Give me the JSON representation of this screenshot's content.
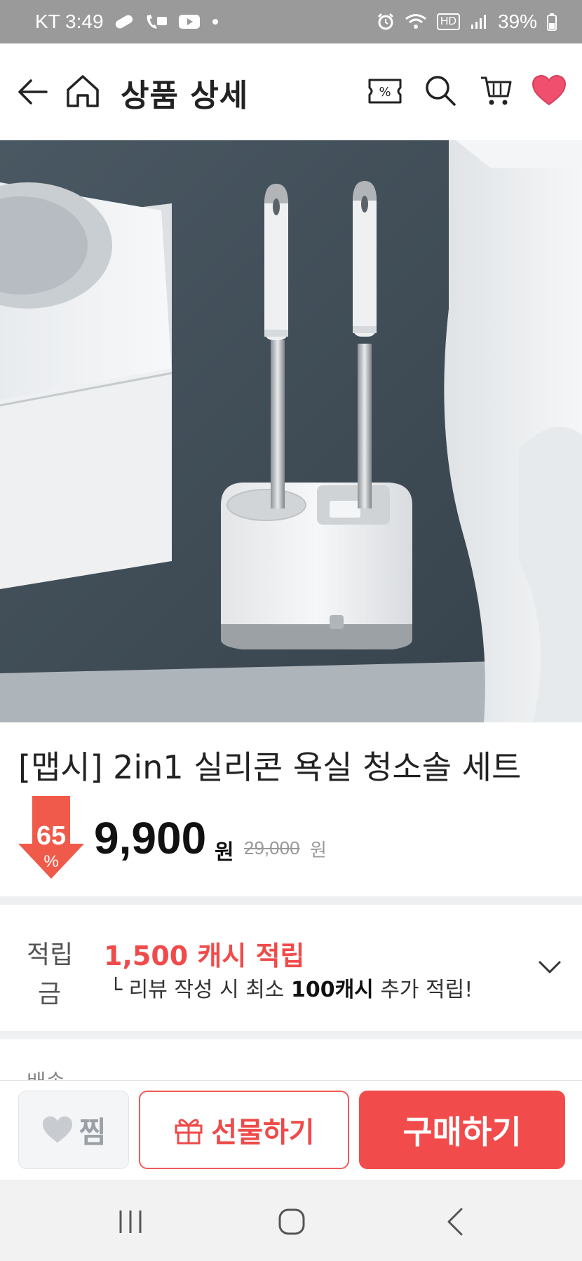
{
  "status_bar": {
    "carrier_time": "KT 3:49",
    "hd_label": "HD",
    "battery": "39%"
  },
  "header": {
    "title": "상품 상세",
    "coupon_glyph": "%"
  },
  "product": {
    "title": "[맵시] 2in1 실리콘 욕실 청소솔 세트",
    "discount_value": "65",
    "discount_sign": "%",
    "price": "9,900",
    "price_unit": "원",
    "original_price": "29,000",
    "original_unit": "원"
  },
  "cash": {
    "label_line1": "적립",
    "label_line2": "금",
    "amount": "1,500 캐시 적립",
    "sub_prefix": "└ 리뷰 작성 시 최소 ",
    "sub_bold": "100캐시",
    "sub_suffix": " 추가 적립!"
  },
  "next_section": {
    "label": "배송"
  },
  "bottom_bar": {
    "wish_label": "찜",
    "gift_label": "선물하기",
    "buy_label": "구매하기"
  },
  "colors": {
    "accent": "#f24b4b",
    "heart": "#f0506e",
    "status_bar": "#9a9a9a"
  }
}
